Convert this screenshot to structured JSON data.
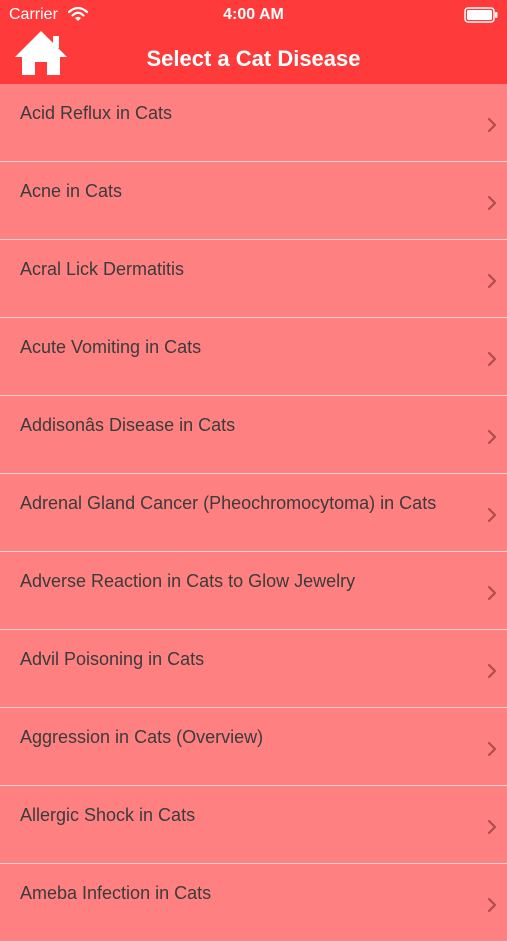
{
  "status_bar": {
    "carrier": "Carrier",
    "time": "4:00 AM",
    "icons": [
      "wifi-icon",
      "battery-icon"
    ]
  },
  "nav": {
    "title": "Select a Cat Disease",
    "home_icon": "home-icon"
  },
  "colors": {
    "nav_background": "#fe3a3a",
    "list_background": "#ff8080",
    "separator": "#ffd2d2",
    "item_text": "#3b3b3b",
    "chevron": "#b34d4d"
  },
  "diseases": [
    "Acid Reflux in Cats",
    "Acne in Cats",
    "Acral Lick Dermatitis",
    "Acute Vomiting in Cats",
    "Addisonâs Disease in Cats",
    "Adrenal Gland Cancer (Pheochromocytoma) in Cats",
    "Adverse Reaction in Cats to Glow Jewelry",
    "Advil Poisoning in Cats",
    "Aggression in Cats (Overview)",
    "Allergic Shock in Cats",
    "Ameba Infection in Cats"
  ]
}
